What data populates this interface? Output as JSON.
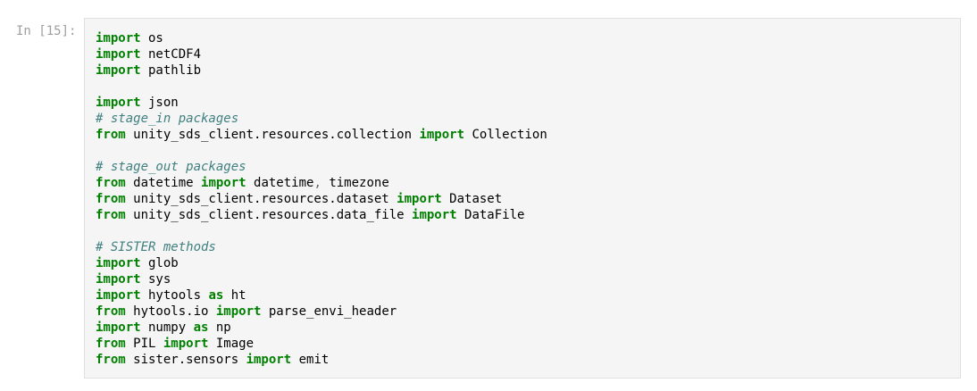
{
  "cell": {
    "prompt": "In [15]:",
    "lines": [
      [
        {
          "t": "kw",
          "v": "import"
        },
        {
          "t": "",
          "v": " os"
        }
      ],
      [
        {
          "t": "kw",
          "v": "import"
        },
        {
          "t": "",
          "v": " netCDF4"
        }
      ],
      [
        {
          "t": "kw",
          "v": "import"
        },
        {
          "t": "",
          "v": " pathlib"
        }
      ],
      [],
      [
        {
          "t": "kw",
          "v": "import"
        },
        {
          "t": "",
          "v": " json"
        }
      ],
      [
        {
          "t": "cm",
          "v": "# stage_in packages"
        }
      ],
      [
        {
          "t": "kw",
          "v": "from"
        },
        {
          "t": "",
          "v": " unity_sds_client.resources.collection "
        },
        {
          "t": "kw",
          "v": "import"
        },
        {
          "t": "",
          "v": " Collection"
        }
      ],
      [],
      [
        {
          "t": "cm",
          "v": "# stage_out packages"
        }
      ],
      [
        {
          "t": "kw",
          "v": "from"
        },
        {
          "t": "",
          "v": " datetime "
        },
        {
          "t": "kw",
          "v": "import"
        },
        {
          "t": "",
          "v": " datetime"
        },
        {
          "t": "op",
          "v": ","
        },
        {
          "t": "",
          "v": " timezone"
        }
      ],
      [
        {
          "t": "kw",
          "v": "from"
        },
        {
          "t": "",
          "v": " unity_sds_client.resources.dataset "
        },
        {
          "t": "kw",
          "v": "import"
        },
        {
          "t": "",
          "v": " Dataset"
        }
      ],
      [
        {
          "t": "kw",
          "v": "from"
        },
        {
          "t": "",
          "v": " unity_sds_client.resources.data_file "
        },
        {
          "t": "kw",
          "v": "import"
        },
        {
          "t": "",
          "v": " DataFile"
        }
      ],
      [],
      [
        {
          "t": "cm",
          "v": "# SISTER methods"
        }
      ],
      [
        {
          "t": "kw",
          "v": "import"
        },
        {
          "t": "",
          "v": " glob"
        }
      ],
      [
        {
          "t": "kw",
          "v": "import"
        },
        {
          "t": "",
          "v": " sys"
        }
      ],
      [
        {
          "t": "kw",
          "v": "import"
        },
        {
          "t": "",
          "v": " hytools "
        },
        {
          "t": "kw",
          "v": "as"
        },
        {
          "t": "",
          "v": " ht"
        }
      ],
      [
        {
          "t": "kw",
          "v": "from"
        },
        {
          "t": "",
          "v": " hytools.io "
        },
        {
          "t": "kw",
          "v": "import"
        },
        {
          "t": "",
          "v": " parse_envi_header"
        }
      ],
      [
        {
          "t": "kw",
          "v": "import"
        },
        {
          "t": "",
          "v": " numpy "
        },
        {
          "t": "kw",
          "v": "as"
        },
        {
          "t": "",
          "v": " np"
        }
      ],
      [
        {
          "t": "kw",
          "v": "from"
        },
        {
          "t": "",
          "v": " PIL "
        },
        {
          "t": "kw",
          "v": "import"
        },
        {
          "t": "",
          "v": " Image"
        }
      ],
      [
        {
          "t": "kw",
          "v": "from"
        },
        {
          "t": "",
          "v": " sister.sensors "
        },
        {
          "t": "kw",
          "v": "import"
        },
        {
          "t": "",
          "v": " emit"
        }
      ]
    ]
  },
  "colors": {
    "keyword": "#008000",
    "comment": "#408080",
    "operator": "#666666",
    "prompt": "#9e9e9e",
    "cell_background": "#f5f5f5",
    "cell_border": "#e0e0e0"
  }
}
